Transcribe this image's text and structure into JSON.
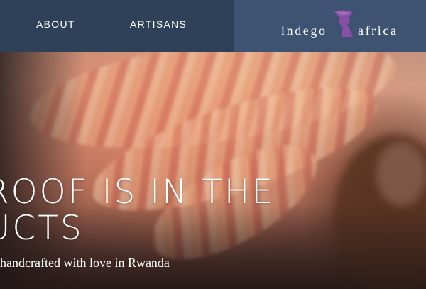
{
  "nav": {
    "links": [
      {
        "label": "ABOUT"
      },
      {
        "label": "ARTISANS"
      }
    ],
    "logo": {
      "left": "indego",
      "right": "africa",
      "icon": "woman-silhouette-icon",
      "icon_color": "#8a4fa6"
    }
  },
  "hero": {
    "headline_line1": "ROOF IS IN THE",
    "headline_line2": "UCTS",
    "subtitle": "handcrafted with love in Rwanda"
  },
  "colors": {
    "nav_left_bg": "#2f4159",
    "nav_right_bg": "#3e5272",
    "text": "#ffffff"
  }
}
